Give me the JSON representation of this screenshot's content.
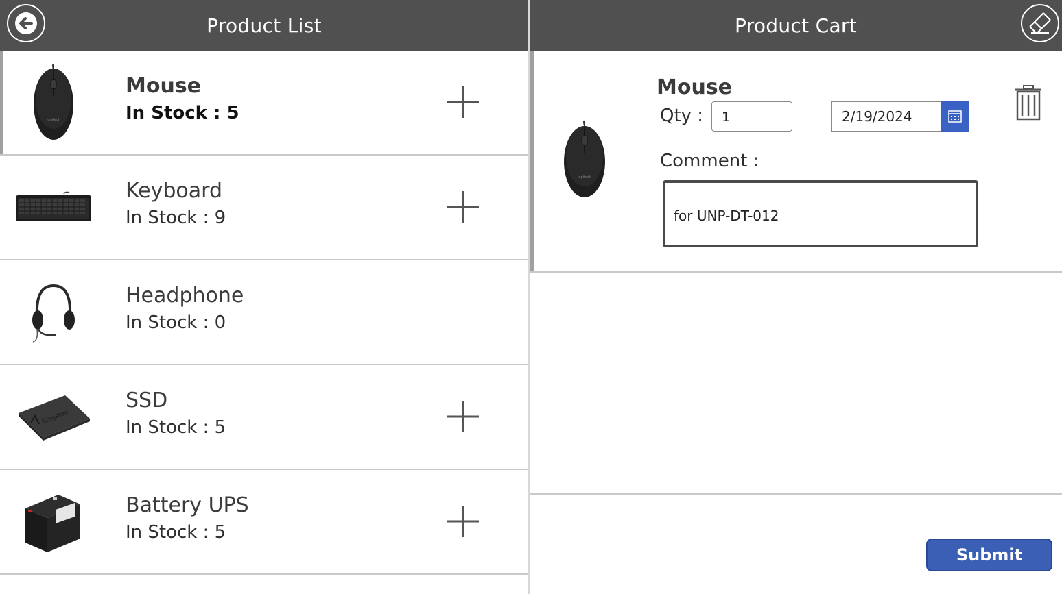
{
  "left_header": {
    "title": "Product List",
    "back_icon": "back-arrow-icon"
  },
  "right_header": {
    "title": "Product Cart",
    "clear_icon": "eraser-icon"
  },
  "products": [
    {
      "name": "Mouse",
      "stock": "In Stock : 5",
      "image": "mouse-image",
      "can_add": true,
      "selected": true
    },
    {
      "name": "Keyboard",
      "stock": "In Stock : 9",
      "image": "keyboard-image",
      "can_add": true,
      "selected": false
    },
    {
      "name": "Headphone",
      "stock": "In Stock : 0",
      "image": "headphone-image",
      "can_add": false,
      "selected": false
    },
    {
      "name": "SSD",
      "stock": "In Stock : 5",
      "image": "ssd-image",
      "can_add": true,
      "selected": false
    },
    {
      "name": "Battery UPS",
      "stock": "In Stock : 5",
      "image": "battery-image",
      "can_add": true,
      "selected": false
    }
  ],
  "cart": {
    "item_name": "Mouse",
    "qty_label": "Qty :",
    "qty_value": "1",
    "date_value": "2/19/2024",
    "comment_label": "Comment :",
    "comment_value": "for UNP-DT-012",
    "submit_label": "Submit"
  },
  "colors": {
    "header": "#505050",
    "accent": "#3a5fb5"
  }
}
